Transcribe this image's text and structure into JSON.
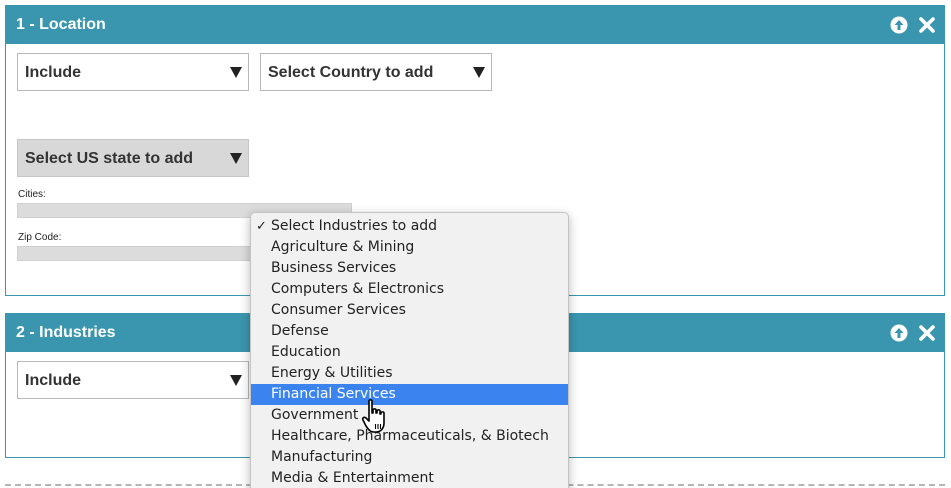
{
  "location_panel": {
    "title": "1 - Location",
    "include_select": "Include",
    "country_select": "Select Country to add",
    "state_select": "Select US state to add",
    "cities_label": "Cities:",
    "zip_label": "Zip Code:",
    "icons": [
      "up-arrow-icon",
      "close-icon"
    ]
  },
  "industries_panel": {
    "title": "2 - Industries",
    "include_select": "Include",
    "icons": [
      "up-arrow-icon",
      "close-icon"
    ]
  },
  "industries_dropdown": {
    "selected_index": 0,
    "highlighted_index": 8,
    "options": [
      "Select Industries to add",
      "Agriculture & Mining",
      "Business Services",
      "Computers & Electronics",
      "Consumer Services",
      "Defense",
      "Education",
      "Energy & Utilities",
      "Financial Services",
      "Government",
      "Healthcare, Pharmaceuticals, & Biotech",
      "Manufacturing",
      "Media & Entertainment"
    ]
  },
  "colors": {
    "header": "#3a96ae",
    "highlight": "#3b84f0"
  }
}
